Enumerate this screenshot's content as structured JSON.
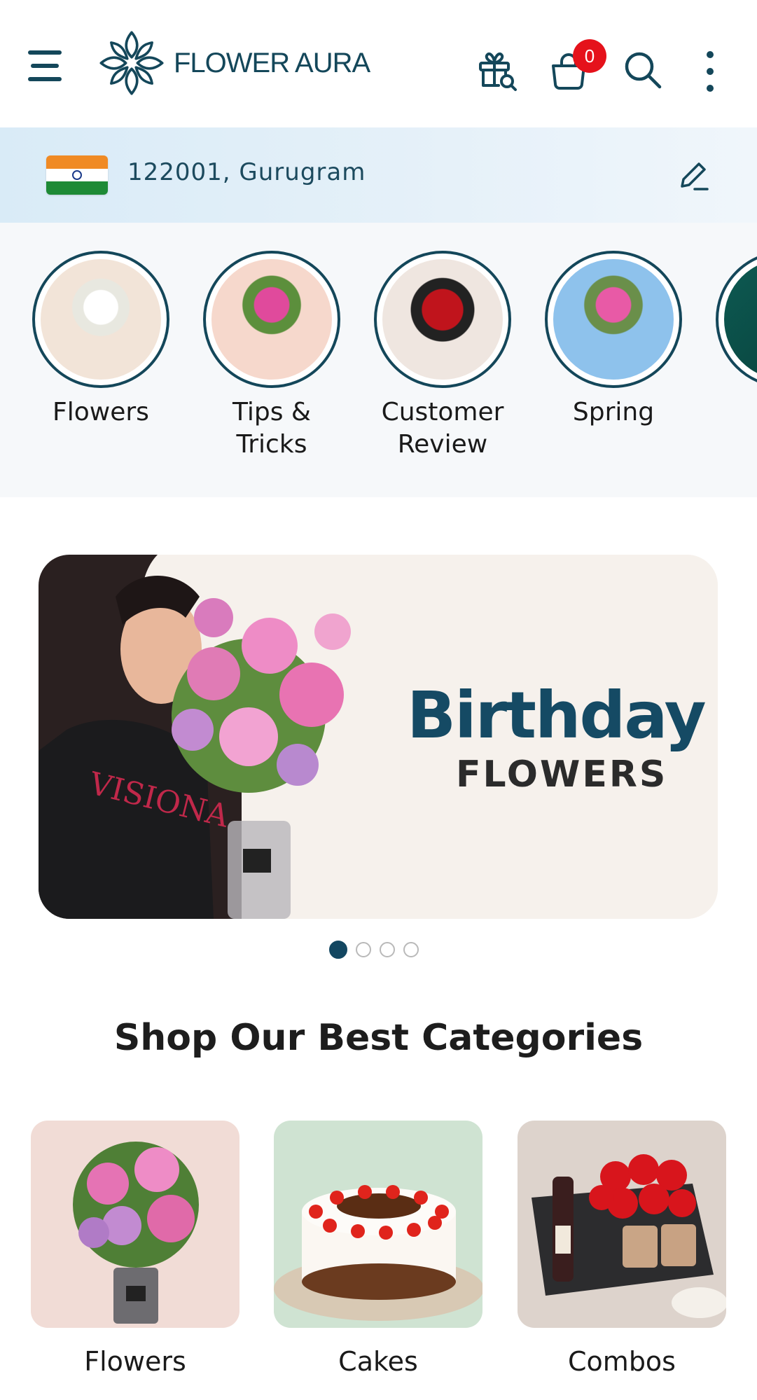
{
  "header": {
    "brand": "FLOWER AURA",
    "cart_count": "0"
  },
  "location": {
    "text": "122001, Gurugram"
  },
  "stories": [
    {
      "label": "Flowers"
    },
    {
      "label": "Tips & Tricks"
    },
    {
      "label": "Customer Review"
    },
    {
      "label": "Spring"
    }
  ],
  "banner": {
    "title": "Birthday",
    "subtitle": "FLOWERS",
    "slides": 4,
    "active_slide": 1
  },
  "categories_section": {
    "title": "Shop Our Best Categories",
    "items": [
      {
        "label": "Flowers"
      },
      {
        "label": "Cakes"
      },
      {
        "label": "Combos"
      }
    ]
  },
  "colors": {
    "brand": "#14475a",
    "badge": "#e5121b",
    "location_bg": "#d9ebf7",
    "stories_bg": "#f6f8fa"
  },
  "icons": [
    "menu-icon",
    "gift-search-icon",
    "cart-icon",
    "search-icon",
    "more-vertical-icon",
    "edit-icon"
  ]
}
